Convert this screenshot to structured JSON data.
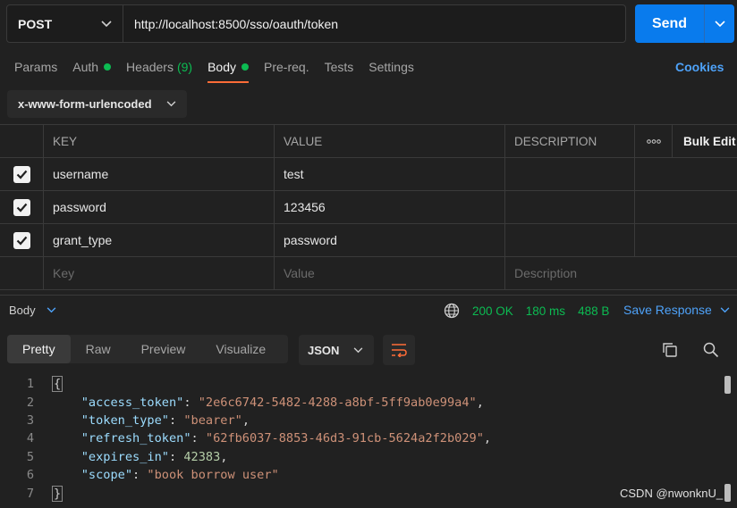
{
  "request": {
    "method": "POST",
    "url": "http://localhost:8500/sso/oauth/token",
    "send_label": "Send"
  },
  "tabs": [
    {
      "label": "Params"
    },
    {
      "label": "Auth"
    },
    {
      "label": "Headers",
      "count": "(9)"
    },
    {
      "label": "Body"
    },
    {
      "label": "Pre-req."
    },
    {
      "label": "Tests"
    },
    {
      "label": "Settings"
    }
  ],
  "cookies_label": "Cookies",
  "body_type": "x-www-form-urlencoded",
  "params_table": {
    "headers": [
      "KEY",
      "VALUE",
      "DESCRIPTION",
      "Bulk Edit"
    ],
    "rows": [
      {
        "key": "username",
        "value": "test"
      },
      {
        "key": "password",
        "value": "123456"
      },
      {
        "key": "grant_type",
        "value": "password"
      }
    ],
    "placeholders": {
      "key": "Key",
      "value": "Value",
      "description": "Description"
    }
  },
  "response": {
    "section_label": "Body",
    "status": "200 OK",
    "time": "180 ms",
    "size": "488 B",
    "save_label": "Save Response",
    "view_tabs": [
      "Pretty",
      "Raw",
      "Preview",
      "Visualize"
    ],
    "format": "JSON"
  },
  "code": {
    "line_numbers": [
      "1",
      "2",
      "3",
      "4",
      "5",
      "6",
      "7"
    ],
    "open": "{",
    "close": "}",
    "entries": [
      {
        "key": "\"access_token\"",
        "value": "\"2e6c6742-5482-4288-a8bf-5ff9ab0e99a4\"",
        "sep": ","
      },
      {
        "key": "\"token_type\"",
        "value": "\"bearer\"",
        "sep": ","
      },
      {
        "key": "\"refresh_token\"",
        "value": "\"62fb6037-8853-46d3-91cb-5624a2f2b029\"",
        "sep": ","
      },
      {
        "key": "\"expires_in\"",
        "value": "42383",
        "sep": ","
      },
      {
        "key": "\"scope\"",
        "value": "\"book borrow user\"",
        "sep": ""
      }
    ]
  },
  "watermark": "CSDN @nwonknU_",
  "colors": {
    "accent": "#ff6c37",
    "send": "#097bed",
    "success": "#0cbb52",
    "link": "#4ea2f9"
  }
}
